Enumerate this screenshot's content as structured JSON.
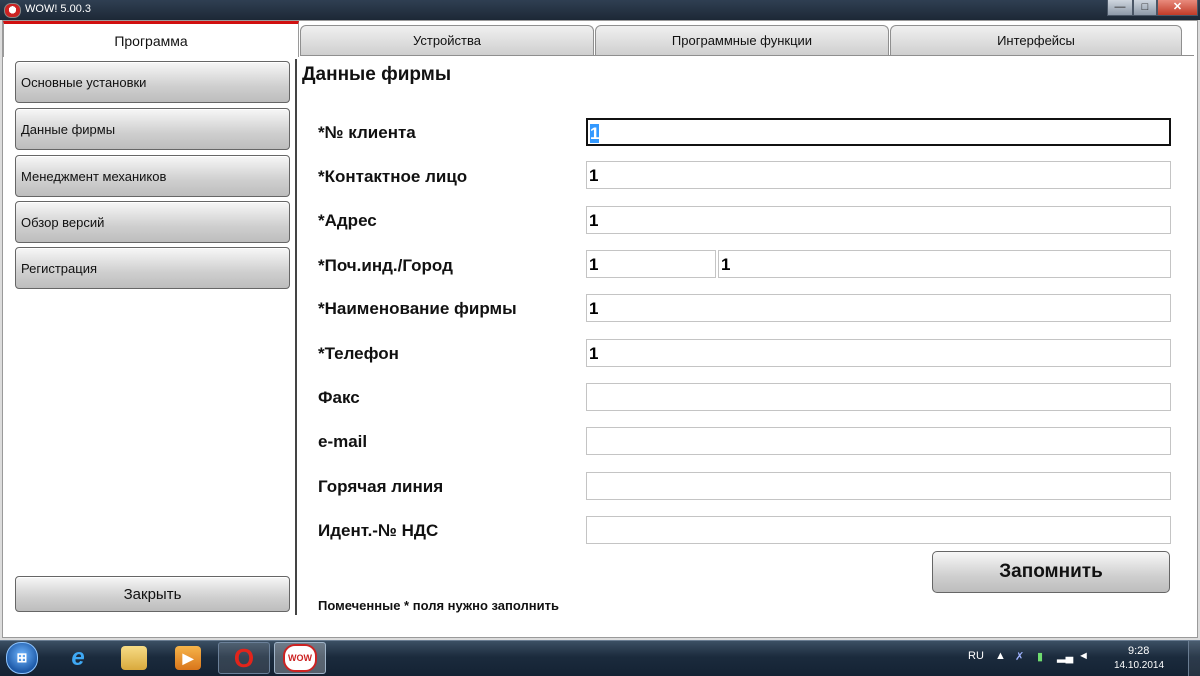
{
  "window": {
    "title": "WOW! 5.00.3",
    "minimize": "—",
    "maximize": "□",
    "close": "✕"
  },
  "tabs": [
    {
      "label": "Программа",
      "active": true
    },
    {
      "label": "Устройства"
    },
    {
      "label": "Программные функции"
    },
    {
      "label": "Интерфейсы"
    }
  ],
  "sidebar": {
    "items": [
      {
        "label": "Основные установки"
      },
      {
        "label": "Данные фирмы"
      },
      {
        "label": "Менеджмент механиков"
      },
      {
        "label": "Обзор версий"
      },
      {
        "label": "Регистрация"
      }
    ],
    "close_label": "Закрыть"
  },
  "form": {
    "title": "Данные фирмы",
    "fields": [
      {
        "label": "*№ клиента",
        "value": "1"
      },
      {
        "label": "*Контактное лицо",
        "value": "1"
      },
      {
        "label": "*Адрес",
        "value": "1"
      },
      {
        "label": "*Поч.инд./Город",
        "zip": "1",
        "city": "1"
      },
      {
        "label": "*Наименование фирмы",
        "value": "1"
      },
      {
        "label": "*Телефон",
        "value": "1"
      },
      {
        "label": "Факс",
        "value": ""
      },
      {
        "label": "e-mail",
        "value": ""
      },
      {
        "label": "Горячая линия",
        "value": ""
      },
      {
        "label": "Идент.-№ НДС",
        "value": ""
      }
    ],
    "save_label": "Запомнить",
    "required_note": "Помеченные * поля нужно заполнить"
  },
  "taskbar": {
    "start_icon": "windows-orb-icon",
    "apps": [
      "internet-explorer-icon",
      "file-explorer-icon",
      "media-player-icon",
      "opera-icon",
      "wow-app-icon"
    ],
    "language": "RU",
    "time": "9:28",
    "date": "14.10.2014"
  },
  "colors": {
    "active_tab_accent": "#d01010",
    "selection": "#3399ff",
    "taskbar": "#1b2b3d"
  }
}
